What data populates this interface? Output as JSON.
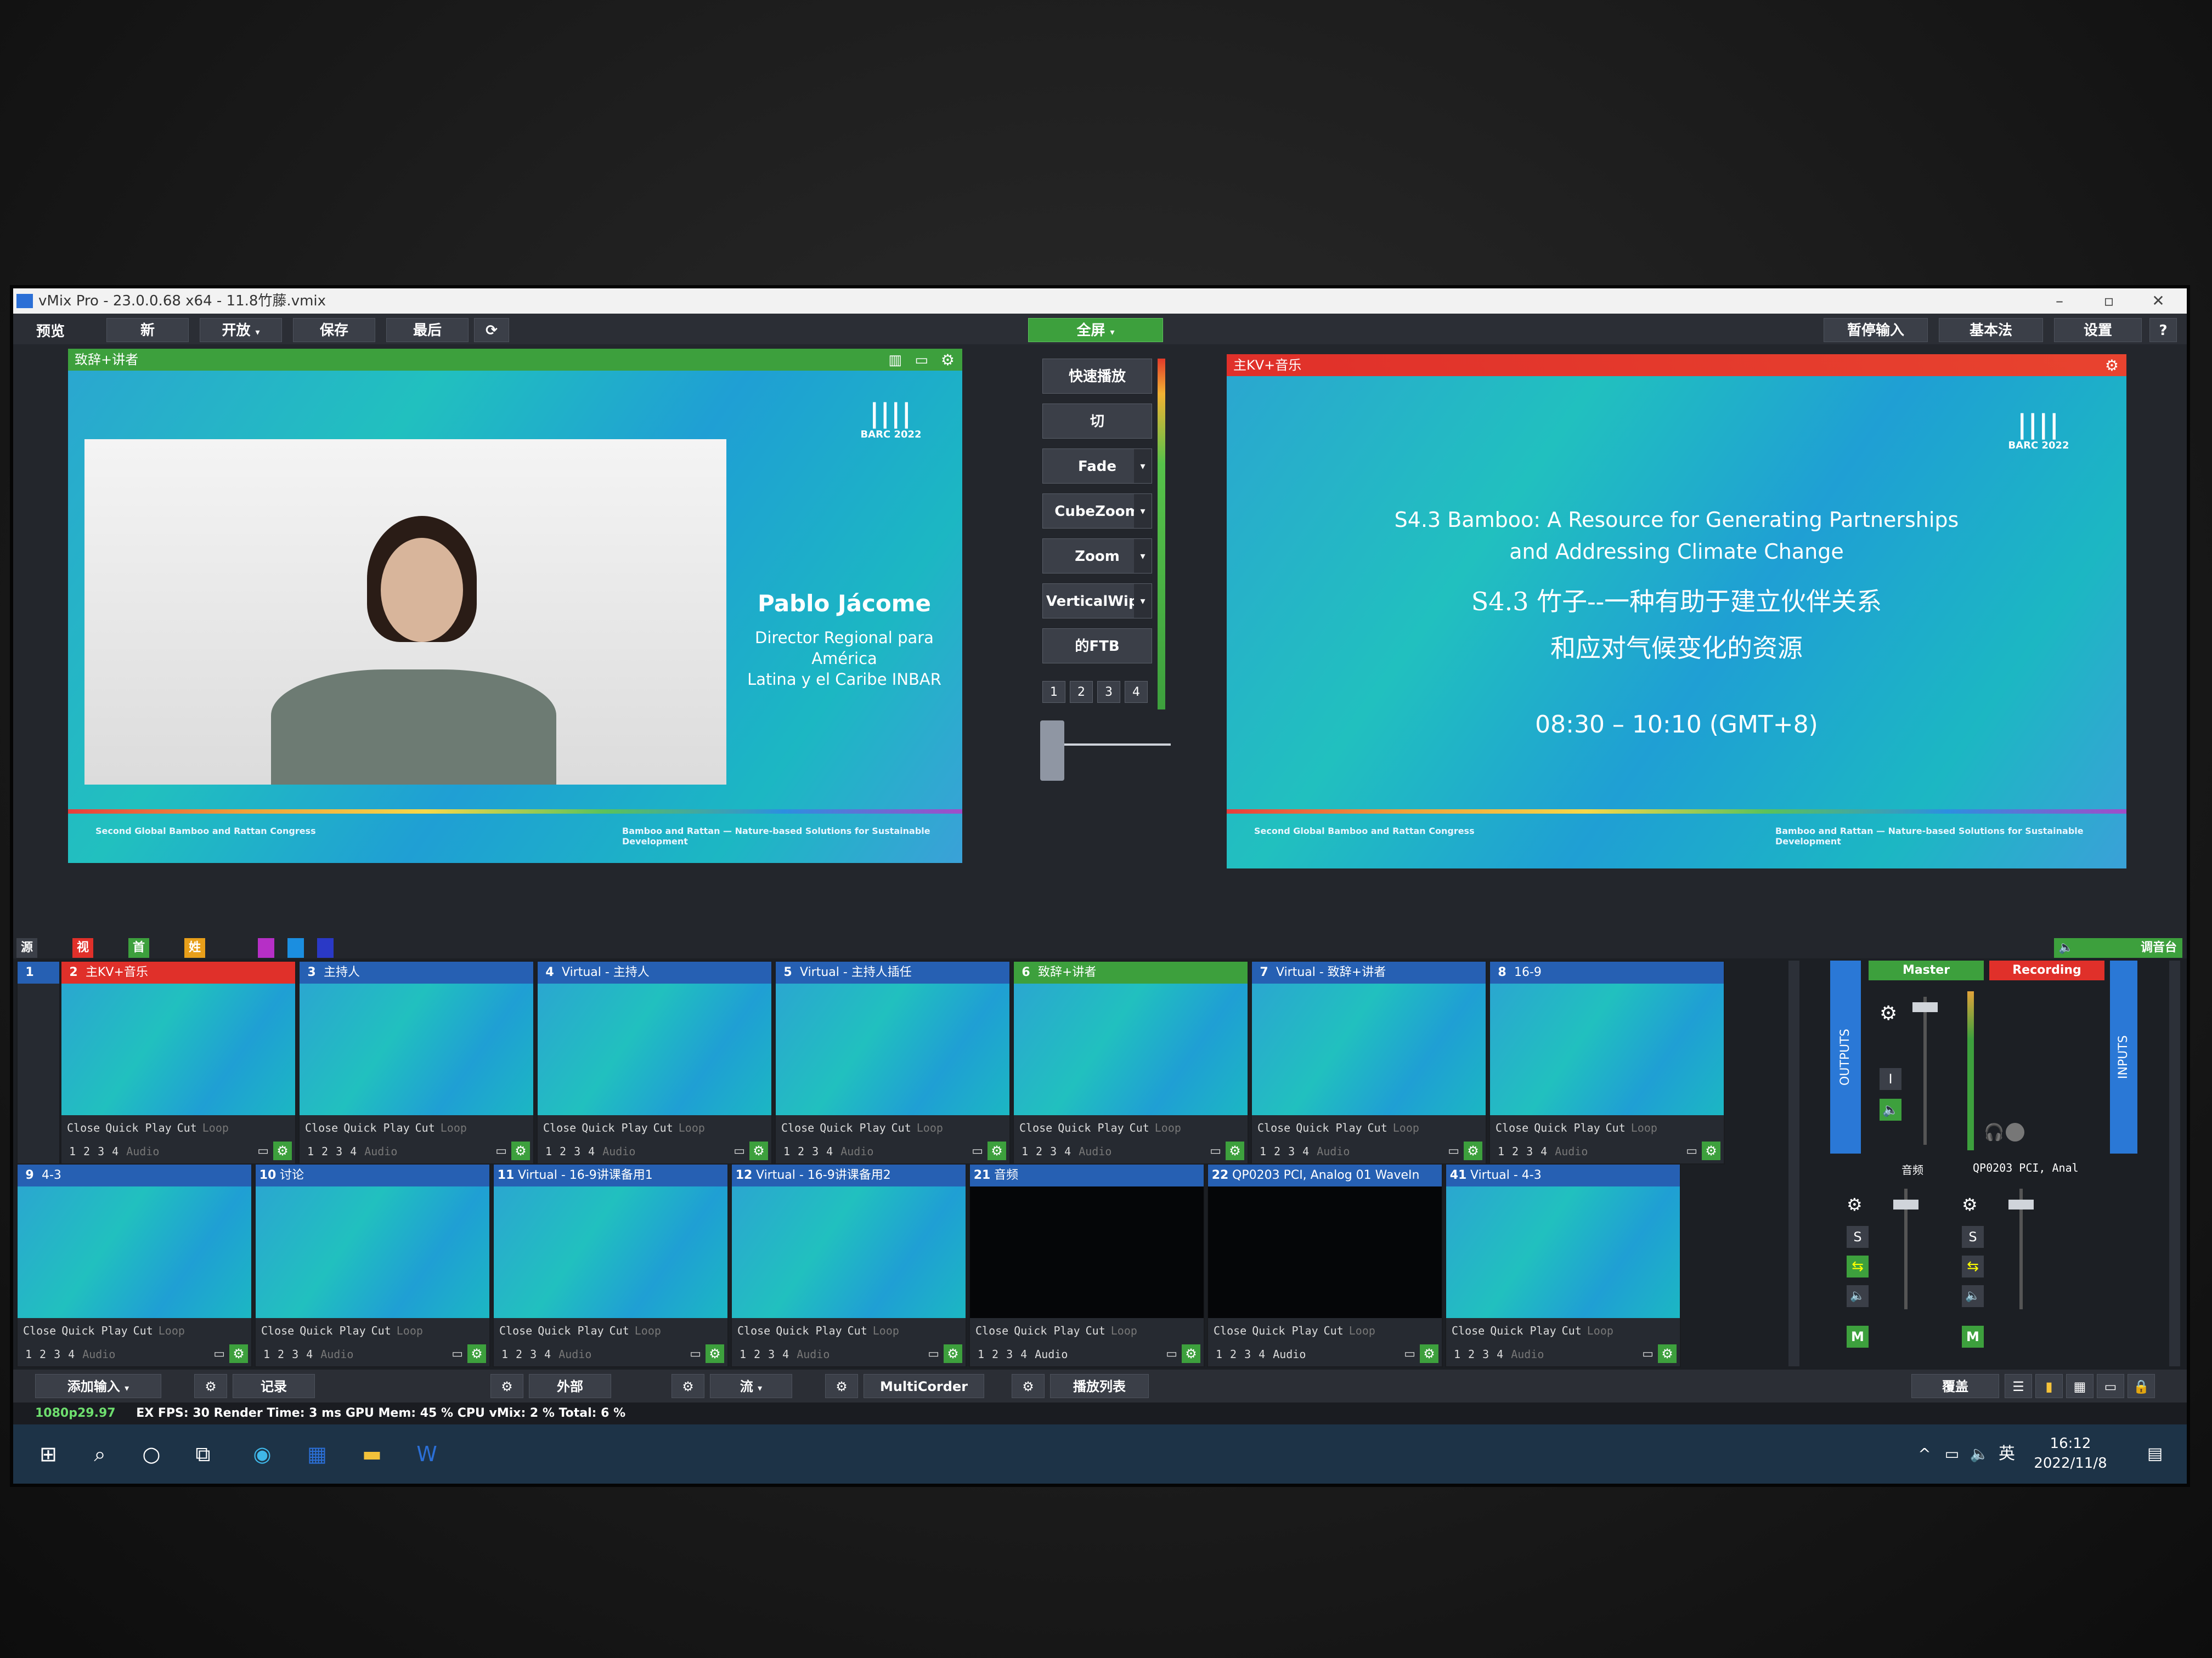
{
  "window": {
    "title": "vMix Pro - 23.0.0.68 x64 - 11.8竹藤.vmix"
  },
  "toolbar": {
    "preview_label": "预览",
    "new": "新",
    "open": "开放",
    "save": "保存",
    "last": "最后",
    "fullscreen": "全屏",
    "pause_input": "暂停输入",
    "basic": "基本法",
    "settings": "设置",
    "help": "?"
  },
  "preview": {
    "title": "致辞+讲者",
    "speaker_name": "Pablo Jácome",
    "speaker_role_1": "Director Regional para",
    "speaker_role_2": "América",
    "speaker_role_3": "Latina y el Caribe INBAR",
    "logo_text": "BARC 2022",
    "footer_left": "Second Global Bamboo and Rattan Congress",
    "footer_right": "Bamboo and Rattan — Nature-based Solutions for Sustainable Development"
  },
  "program": {
    "title": "主KV+音乐",
    "line_en_1": "S4.3 Bamboo: A Resource for Generating Partnerships",
    "line_en_2": "and Addressing Climate Change",
    "line_cn_1": "S4.3 竹子--一种有助于建立伙伴关系",
    "line_cn_2": "和应对气候变化的资源",
    "time": "08:30 – 10:10 (GMT+8)",
    "logo_text": "BARC 2022",
    "footer_left": "Second Global Bamboo and Rattan Congress",
    "footer_right": "Bamboo and Rattan — Nature-based Solutions for Sustainable Development"
  },
  "transitions": {
    "quick_play": "快速播放",
    "cut": "切",
    "fade": "Fade",
    "cubezoom": "CubeZoom",
    "zoom": "Zoom",
    "verticalwipe": "VerticalWipe",
    "ftb": "的FTB",
    "nums": [
      "1",
      "2",
      "3",
      "4"
    ]
  },
  "tabs": {
    "sources": "源文件",
    "video": "视频",
    "home": "首播",
    "name_unit": "姓名单位",
    "mixer": "调音台"
  },
  "tile_controls": {
    "close": "Close",
    "quick_play": "Quick Play",
    "cut": "Cut",
    "loop": "Loop",
    "audio": "Audio",
    "n1": "1",
    "n2": "2",
    "n3": "3",
    "n4": "4"
  },
  "inputs": [
    {
      "num": "1",
      "label": ""
    },
    {
      "num": "2",
      "label": "主KV+音乐"
    },
    {
      "num": "3",
      "label": "主持人"
    },
    {
      "num": "4",
      "label": "Virtual - 主持人"
    },
    {
      "num": "5",
      "label": "Virtual - 主持人插任"
    },
    {
      "num": "6",
      "label": "致辞+讲者"
    },
    {
      "num": "7",
      "label": "Virtual - 致辞+讲者"
    },
    {
      "num": "8",
      "label": "16-9"
    },
    {
      "num": "9",
      "label": "4-3"
    },
    {
      "num": "10",
      "label": "讨论"
    },
    {
      "num": "11",
      "label": "Virtual - 16-9讲课备用1"
    },
    {
      "num": "12",
      "label": "Virtual - 16-9讲课备用2"
    },
    {
      "num": "21",
      "label": "音频"
    },
    {
      "num": "22",
      "label": "QP0203 PCI, Analog 01 WaveIn"
    },
    {
      "num": "41",
      "label": "Virtual - 4-3"
    }
  ],
  "audio": {
    "master": "Master",
    "recording": "Recording",
    "outputs": "OUTPUTS",
    "inputs": "INPUTS",
    "ch1": "音频",
    "ch2": "QP0203 PCI, Anal",
    "s": "S",
    "m": "M",
    "i": "I"
  },
  "bottom_bar": {
    "add_input": "添加输入",
    "record": "记录",
    "external": "外部",
    "stream": "流",
    "multicorder": "MultiCorder",
    "playlist": "播放列表",
    "overlay": "覆盖"
  },
  "status": {
    "format": "1080p29.97",
    "stats": "EX FPS: 30 Render Time: 3 ms GPU Mem: 45 % CPU vMix: 2 % Total: 6 %"
  },
  "taskbar": {
    "time": "16:12",
    "date": "2022/11/8",
    "lang": "英"
  },
  "colors": {
    "accent_green": "#3da03d",
    "program_red": "#e0302a",
    "input_blue": "#2660b3"
  }
}
